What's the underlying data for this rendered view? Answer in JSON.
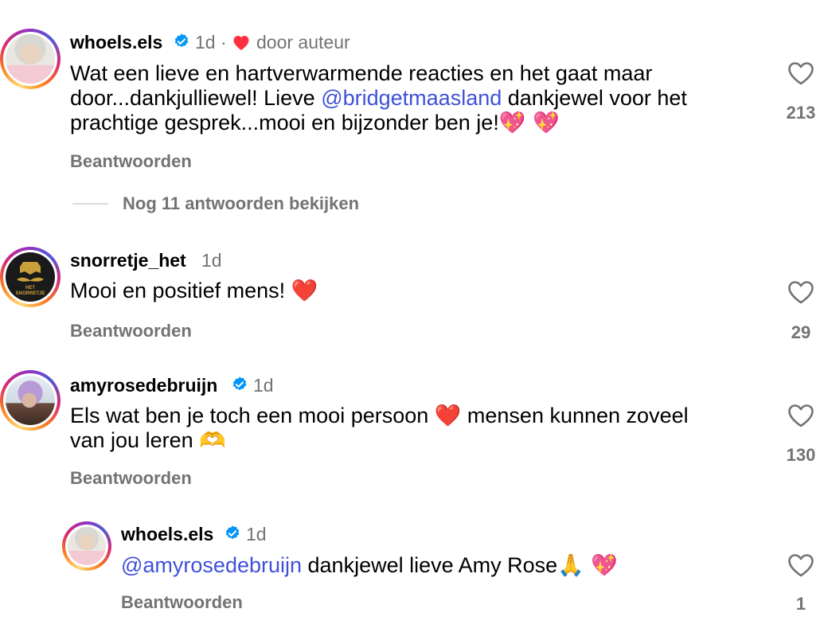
{
  "comments": [
    {
      "username": "whoels.els",
      "verified": true,
      "time": "1d",
      "separator": "·",
      "author_badge": "door auteur",
      "text_lines": [
        [
          {
            "t": "Wat een lieve en hartverwarmende reacties en het gaat maar"
          }
        ],
        [
          {
            "t": "door...dankjulliewel! Lieve "
          },
          {
            "m": "@bridgetmaasland"
          },
          {
            "t": " dankjewel voor het"
          }
        ],
        [
          {
            "t": "prachtige gesprek...mooi en bijzonder ben je!"
          },
          {
            "e": "💖 💖"
          }
        ]
      ],
      "reply_label": "Beantwoorden",
      "like_count": "213",
      "view_replies": "Nog 11 antwoorden bekijken"
    },
    {
      "username": "snorretje_het",
      "verified": false,
      "time": "1d",
      "avatar_text": "HET SNORRETJE",
      "text_lines": [
        [
          {
            "t": "Mooi en positief mens! "
          },
          {
            "e": "❤️"
          }
        ]
      ],
      "reply_label": "Beantwoorden",
      "like_count": "29"
    },
    {
      "username": "amyrosedebruijn",
      "verified": true,
      "time": "1d",
      "text_lines": [
        [
          {
            "t": "Els wat ben je toch een mooi persoon "
          },
          {
            "e": "❤️"
          },
          {
            "t": " mensen kunnen zoveel"
          }
        ],
        [
          {
            "t": "van jou leren "
          },
          {
            "e": "🫶"
          }
        ]
      ],
      "reply_label": "Beantwoorden",
      "like_count": "130"
    },
    {
      "username": "whoels.els",
      "verified": true,
      "time": "1d",
      "text_lines": [
        [
          {
            "m": "@amyrosedebruijn"
          },
          {
            "t": " dankjewel lieve Amy Rose"
          },
          {
            "e": "🙏 💖"
          }
        ]
      ],
      "reply_label": "Beantwoorden",
      "like_count": "1"
    }
  ],
  "colors": {
    "mention": "#3f51d8",
    "secondary_text": "#737373",
    "verified": "#0095f6",
    "heart_red": "#ff3040"
  }
}
